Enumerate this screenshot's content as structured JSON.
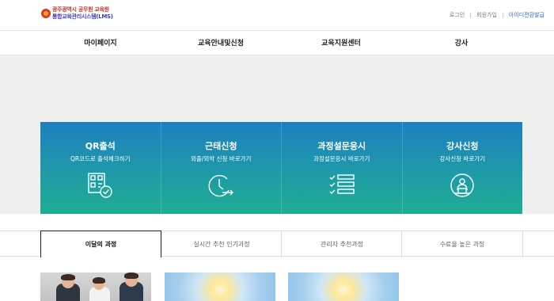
{
  "header": {
    "logo_line1": "광주광역시 공무원 교육원",
    "logo_line2": "통합교육관리시스템(LMS)",
    "util": {
      "login": "로그인",
      "signup": "회원가입",
      "id_issue": "아이디전환발급"
    }
  },
  "nav": {
    "items": [
      "마이페이지",
      "교육안내및신청",
      "교육지원센터",
      "강사"
    ]
  },
  "tiles": [
    {
      "title": "QR출석",
      "sub": "QR코드로 출석체크하기",
      "icon": "qr-check-icon"
    },
    {
      "title": "근태신청",
      "sub": "외출/외박 신청 바로가기",
      "icon": "clock-arrow-icon"
    },
    {
      "title": "과정설문응시",
      "sub": "과정설문응시 바로가기",
      "icon": "checklist-icon"
    },
    {
      "title": "강사신청",
      "sub": "강사신청 바로가기",
      "icon": "lecturer-icon"
    }
  ],
  "tabs": {
    "items": [
      "이달의 과정",
      "실시간 추천 인기과정",
      "관리자 추천과정",
      "수료율 높은 과정"
    ],
    "active_index": 0
  },
  "colors": {
    "tile_gradient_top": "#1e7fc0",
    "tile_gradient_bottom": "#1fae93",
    "accent_link": "#2a6cc7",
    "logo_red": "#c0392b",
    "logo_blue": "#3c3cc8"
  }
}
